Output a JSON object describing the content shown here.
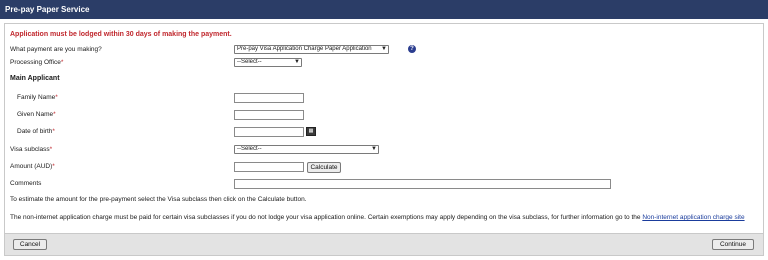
{
  "header": {
    "title": "Pre-pay Paper Service"
  },
  "warning": "Application must be lodged within 30 days of making the payment.",
  "form": {
    "payment_type": {
      "label": "What payment are you making?",
      "value": "Pre-pay Visa Application Charge Paper Application"
    },
    "processing_office": {
      "label": "Processing Office",
      "value": "--Select--"
    },
    "main_applicant_heading": "Main Applicant",
    "family_name_label": "Family Name",
    "given_name_label": "Given Name",
    "dob_label": "Date of birth",
    "visa_subclass": {
      "label": "Visa subclass",
      "value": "--Select--"
    },
    "amount_label": "Amount (AUD)",
    "calculate_label": "Calculate",
    "comments_label": "Comments",
    "required_marker": "*"
  },
  "notes": {
    "estimate": "To estimate the amount for the pre-payment select the Visa subclass then click on the Calculate button.",
    "non_internet_text": "The non-internet application charge must be paid for certain visa subclasses if you do not lodge your visa application online. Certain exemptions may apply depending on the visa subclass, for further information go to the",
    "non_internet_link": "Non-internet application charge site"
  },
  "footer": {
    "cancel_label": "Cancel",
    "continue_label": "Continue"
  },
  "icons": {
    "help": "help-icon",
    "calendar": "calendar-icon",
    "dropdown": "chevron-down-icon"
  },
  "colors": {
    "header_bg": "#2b3d67",
    "warning": "#c0272d",
    "link": "#1a3c9c",
    "footer_bg": "#e3e3e3"
  }
}
